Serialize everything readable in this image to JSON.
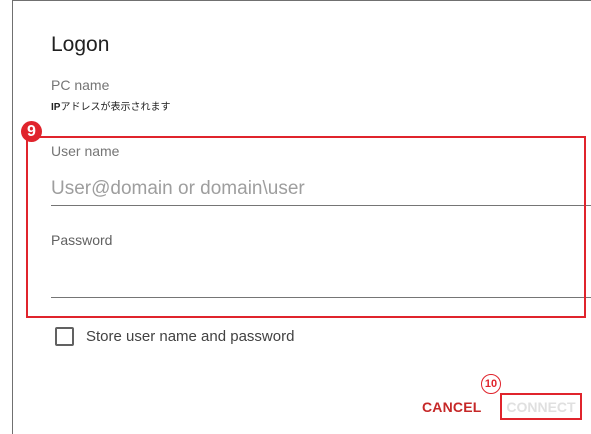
{
  "dialog": {
    "title": "Logon",
    "pc_name_label": "PC name",
    "pc_name_value_prefix": "IP",
    "pc_name_value_rest": "アドレスが表示されます",
    "user_name_label": "User name",
    "user_name_placeholder": "User@domain or domain\\user",
    "password_label": "Password",
    "store_label": "Store user name and password",
    "cancel_label": "CANCEL",
    "connect_label": "CONNECT"
  },
  "annotations": {
    "badge_9": "9",
    "badge_10": "10"
  },
  "colors": {
    "annotation_red": "#e0242c",
    "cancel_red": "#c62828",
    "connect_disabled": "#e0e0e0"
  }
}
